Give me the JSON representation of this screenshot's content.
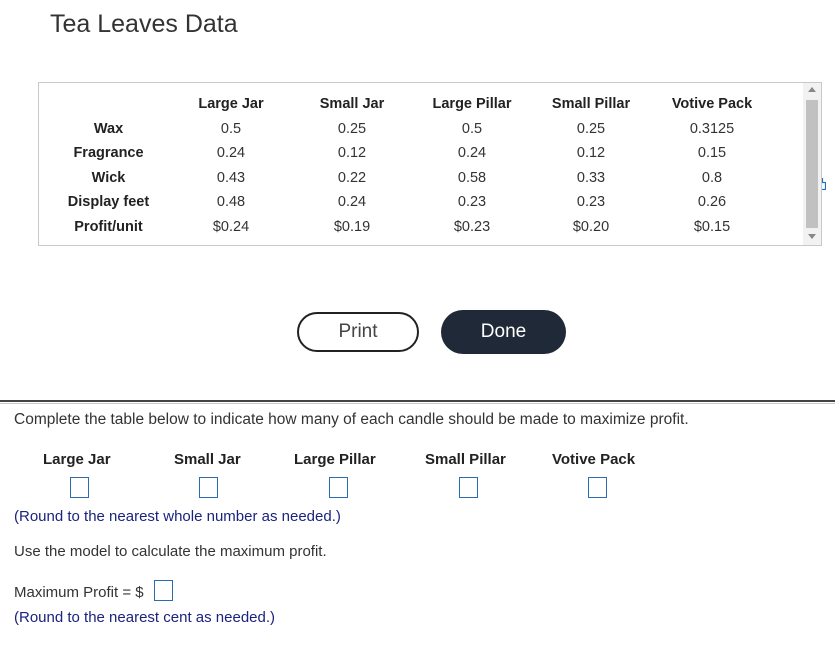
{
  "title": "Tea Leaves Data",
  "table": {
    "columns": [
      "Large Jar",
      "Small Jar",
      "Large Pillar",
      "Small Pillar",
      "Votive Pack"
    ],
    "rows": [
      {
        "label": "Wax",
        "values": [
          "0.5",
          "0.25",
          "0.5",
          "0.25",
          "0.3125"
        ]
      },
      {
        "label": "Fragrance",
        "values": [
          "0.24",
          "0.12",
          "0.24",
          "0.12",
          "0.15"
        ]
      },
      {
        "label": "Wick",
        "values": [
          "0.43",
          "0.22",
          "0.58",
          "0.33",
          "0.8"
        ]
      },
      {
        "label": "Display feet",
        "values": [
          "0.48",
          "0.24",
          "0.23",
          "0.23",
          "0.26"
        ]
      },
      {
        "label": "Profit/unit",
        "values": [
          "$0.24",
          "$0.19",
          "$0.23",
          "$0.20",
          "$0.15"
        ]
      }
    ]
  },
  "buttons": {
    "print": "Print",
    "done": "Done"
  },
  "question": {
    "instruction": "Complete the table below to indicate how many of each candle should be made to maximize profit.",
    "answer_columns": [
      "Large Jar",
      "Small Jar",
      "Large Pillar",
      "Small Pillar",
      "Votive Pack"
    ],
    "round_note_1": "(Round to the nearest whole number as needed.)",
    "model_prompt": "Use the model to calculate the maximum profit.",
    "max_profit_label": "Maximum Profit = $",
    "round_note_2": "(Round to the nearest cent as needed.)"
  }
}
